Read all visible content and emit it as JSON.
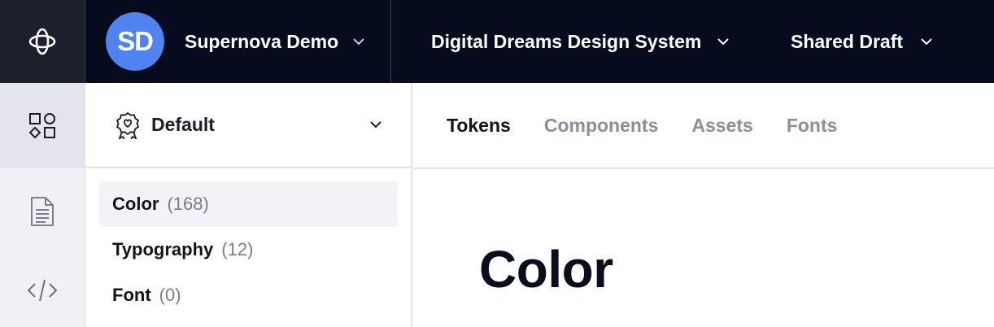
{
  "header": {
    "logo_icon": "supernova-logo-icon",
    "workspace": {
      "initials": "SD",
      "name": "Supernova Demo",
      "avatar_color": "#4f83f0"
    },
    "design_system": {
      "name": "Digital Dreams Design System"
    },
    "version": {
      "name": "Shared Draft"
    }
  },
  "rail": {
    "items": [
      {
        "icon": "components-grid-icon",
        "active": true
      },
      {
        "icon": "document-icon",
        "active": false
      },
      {
        "icon": "code-icon",
        "active": false
      }
    ]
  },
  "sidebar": {
    "brand": {
      "icon": "badge-heart-icon",
      "label": "Default"
    },
    "items": [
      {
        "label": "Color",
        "count": "(168)",
        "active": true
      },
      {
        "label": "Typography",
        "count": "(12)",
        "active": false
      },
      {
        "label": "Font",
        "count": "(0)",
        "active": false
      }
    ]
  },
  "tabs": [
    {
      "label": "Tokens",
      "active": true
    },
    {
      "label": "Components",
      "active": false
    },
    {
      "label": "Assets",
      "active": false
    },
    {
      "label": "Fonts",
      "active": false
    }
  ],
  "main": {
    "title": "Color"
  },
  "colors": {
    "topbar": "#070b1e",
    "accent": "#4f83f0",
    "muted_text": "#8b8e9c"
  }
}
